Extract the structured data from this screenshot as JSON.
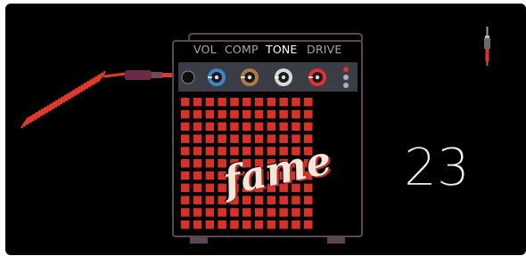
{
  "amp": {
    "knobs": [
      {
        "label": "VOL",
        "ring_color": "#3f84c9",
        "active": false
      },
      {
        "label": "COMP",
        "ring_color": "#b07a48",
        "active": false
      },
      {
        "label": "TONE",
        "ring_color": "#d8d8d8",
        "active": true
      },
      {
        "label": "DRIVE",
        "ring_color": "#e03231",
        "active": false
      }
    ],
    "brand_text": "fame",
    "grille_color": "#d63228"
  },
  "counter": {
    "value": "23"
  },
  "colors": {
    "background": "#000000",
    "cable": "#e03a2c",
    "amp_outline": "#5b4657"
  },
  "icons": [
    "guitar-cable-icon",
    "jack-plug-icon"
  ]
}
